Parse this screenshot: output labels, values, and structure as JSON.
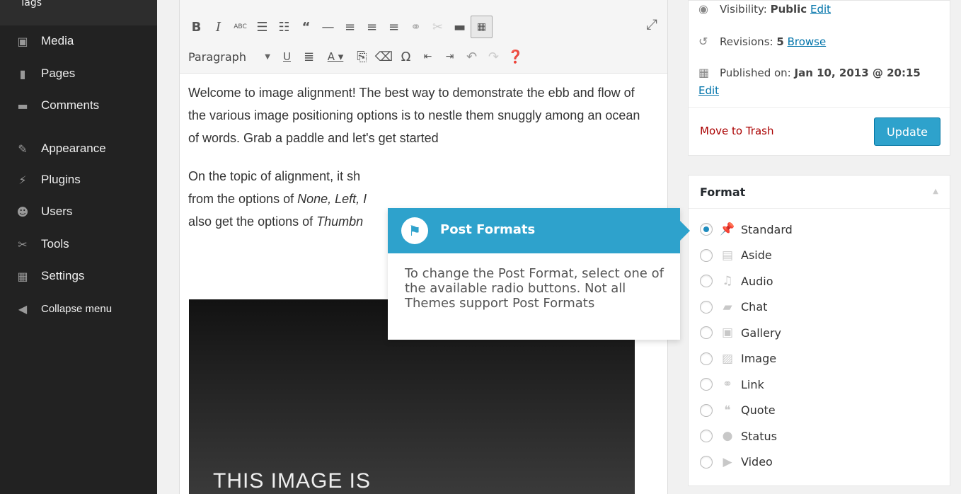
{
  "sidebar": {
    "top_item": "Tags",
    "items": [
      {
        "label": "Media",
        "icon": "media-icon",
        "glyph": "▣"
      },
      {
        "label": "Pages",
        "icon": "pages-icon",
        "glyph": "▮"
      },
      {
        "label": "Comments",
        "icon": "comments-icon",
        "glyph": "▬"
      },
      {
        "label": "Appearance",
        "icon": "appearance-icon",
        "glyph": "✎"
      },
      {
        "label": "Plugins",
        "icon": "plugins-icon",
        "glyph": "⚡"
      },
      {
        "label": "Users",
        "icon": "users-icon",
        "glyph": "☻"
      },
      {
        "label": "Tools",
        "icon": "tools-icon",
        "glyph": "✂"
      },
      {
        "label": "Settings",
        "icon": "settings-icon",
        "glyph": "▦"
      },
      {
        "label": "Collapse menu",
        "icon": "collapse-icon",
        "glyph": "◀"
      }
    ]
  },
  "editor": {
    "format_select": "Paragraph",
    "paragraph1": "Welcome to image alignment! The best way to demonstrate the ebb and flow of the various image positioning options is to nestle them snuggly among an ocean of words. Grab a paddle and let's get started",
    "paragraph2_start": "On the topic of alignment, it sh",
    "paragraph2_line2_start": "from the options of ",
    "paragraph2_line2_em": "None, Left, I",
    "paragraph2_line3_start": "also get the options of ",
    "paragraph2_line3_em": "Thumbn",
    "image_text": "THIS IMAGE IS"
  },
  "publish": {
    "visibility_label": "Visibility:",
    "visibility_value": "Public",
    "visibility_edit": "Edit",
    "revisions_label": "Revisions:",
    "revisions_value": "5",
    "revisions_link": "Browse",
    "published_label": "Published on:",
    "published_value": "Jan 10, 2013 @ 20:15",
    "published_edit": "Edit",
    "trash": "Move to Trash",
    "update": "Update",
    "accent": "#2ea2cc"
  },
  "format": {
    "title": "Format",
    "items": [
      {
        "label": "Standard",
        "icon": "pin-icon",
        "glyph": "📌",
        "checked": true
      },
      {
        "label": "Aside",
        "icon": "aside-icon",
        "glyph": "▤",
        "checked": false
      },
      {
        "label": "Audio",
        "icon": "audio-icon",
        "glyph": "♫",
        "checked": false
      },
      {
        "label": "Chat",
        "icon": "chat-icon",
        "glyph": "▰",
        "checked": false
      },
      {
        "label": "Gallery",
        "icon": "gallery-icon",
        "glyph": "▣",
        "checked": false
      },
      {
        "label": "Image",
        "icon": "image-icon",
        "glyph": "▨",
        "checked": false
      },
      {
        "label": "Link",
        "icon": "link-icon",
        "glyph": "⚭",
        "checked": false
      },
      {
        "label": "Quote",
        "icon": "quote-icon",
        "glyph": "❝",
        "checked": false
      },
      {
        "label": "Status",
        "icon": "status-icon",
        "glyph": "●",
        "checked": false
      },
      {
        "label": "Video",
        "icon": "video-icon",
        "glyph": "▶",
        "checked": false
      }
    ]
  },
  "tooltip": {
    "title": "Post Formats",
    "body": "To change the Post Format, select one of the available radio buttons. Not all Themes support Post Formats"
  }
}
